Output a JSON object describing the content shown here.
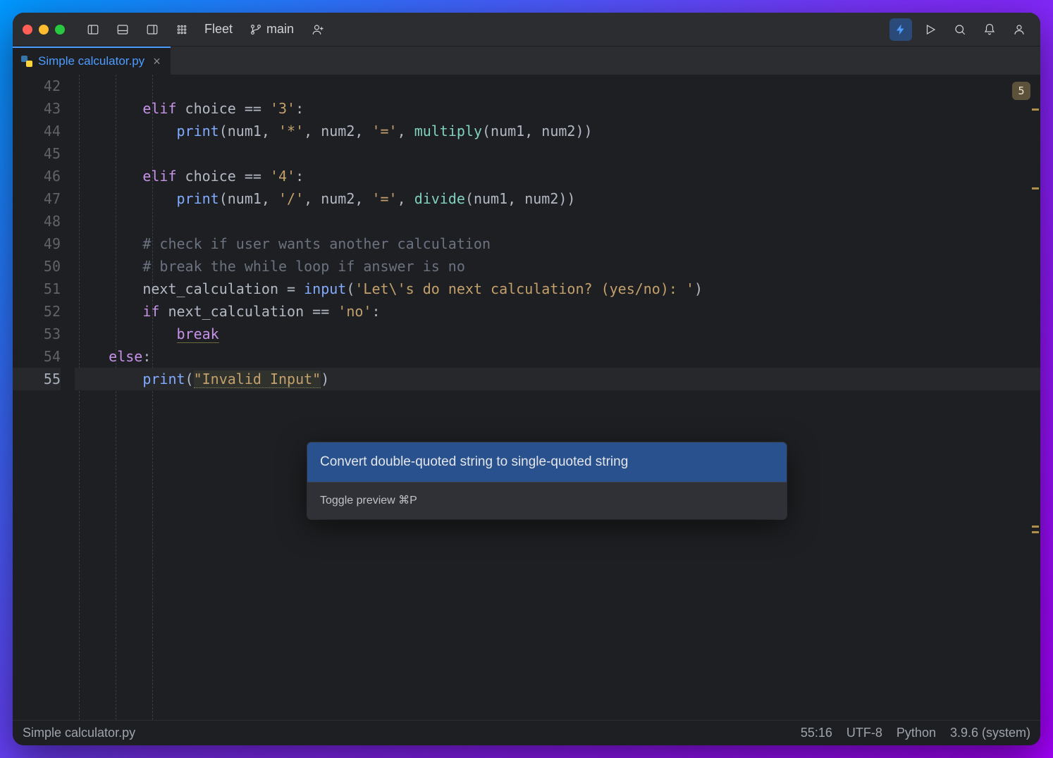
{
  "app": {
    "name": "Fleet"
  },
  "branch": {
    "name": "main"
  },
  "tab": {
    "filename": "Simple calculator.py"
  },
  "problems": {
    "count": "5"
  },
  "code": {
    "lines": [
      {
        "n": "42",
        "indent": "            ",
        "tokens": []
      },
      {
        "n": "43",
        "indent": "        ",
        "tokens": [
          [
            "kw",
            "elif"
          ],
          [
            "op",
            " choice == "
          ],
          [
            "str",
            "'3'"
          ],
          [
            "op",
            ":"
          ]
        ]
      },
      {
        "n": "44",
        "indent": "            ",
        "tokens": [
          [
            "fn",
            "print"
          ],
          [
            "op",
            "(num1, "
          ],
          [
            "str",
            "'*'"
          ],
          [
            "op",
            ", num2, "
          ],
          [
            "str",
            "'='"
          ],
          [
            "op",
            ", "
          ],
          [
            "call",
            "multiply"
          ],
          [
            "op",
            "(num1, num2))"
          ]
        ]
      },
      {
        "n": "45",
        "indent": "",
        "tokens": []
      },
      {
        "n": "46",
        "indent": "        ",
        "tokens": [
          [
            "kw",
            "elif"
          ],
          [
            "op",
            " choice == "
          ],
          [
            "str",
            "'4'"
          ],
          [
            "op",
            ":"
          ]
        ]
      },
      {
        "n": "47",
        "indent": "            ",
        "tokens": [
          [
            "fn",
            "print"
          ],
          [
            "op",
            "(num1, "
          ],
          [
            "str",
            "'/'"
          ],
          [
            "op",
            ", num2, "
          ],
          [
            "str",
            "'='"
          ],
          [
            "op",
            ", "
          ],
          [
            "call",
            "divide"
          ],
          [
            "op",
            "(num1, num2))"
          ]
        ]
      },
      {
        "n": "48",
        "indent": "",
        "tokens": []
      },
      {
        "n": "49",
        "indent": "        ",
        "tokens": [
          [
            "cmt",
            "# check if user wants another calculation"
          ]
        ]
      },
      {
        "n": "50",
        "indent": "        ",
        "tokens": [
          [
            "cmt",
            "# break the while loop if answer is no"
          ]
        ]
      },
      {
        "n": "51",
        "indent": "        ",
        "tokens": [
          [
            "id",
            "next_calculation = "
          ],
          [
            "fn",
            "input"
          ],
          [
            "op",
            "("
          ],
          [
            "str",
            "'Let\\'s do next calculation? (yes/no): '"
          ],
          [
            "op",
            ")"
          ]
        ]
      },
      {
        "n": "52",
        "indent": "        ",
        "tokens": [
          [
            "kw",
            "if"
          ],
          [
            "op",
            " next_calculation == "
          ],
          [
            "str",
            "'no'"
          ],
          [
            "op",
            ":"
          ]
        ]
      },
      {
        "n": "53",
        "indent": "            ",
        "tokens": [
          [
            "kw underline-soft",
            "break"
          ]
        ]
      },
      {
        "n": "54",
        "indent": "    ",
        "tokens": [
          [
            "kw",
            "else"
          ],
          [
            "op",
            ":"
          ]
        ]
      },
      {
        "n": "55",
        "indent": "        ",
        "hl": true,
        "tokens": [
          [
            "fn",
            "print"
          ],
          [
            "op",
            "("
          ],
          [
            "str str-hl",
            "\"Invalid Input\""
          ],
          [
            "op",
            ")"
          ]
        ]
      }
    ]
  },
  "popup": {
    "action": "Convert double-quoted string to single-quoted string",
    "footer": "Toggle preview ⌘P"
  },
  "status": {
    "file": "Simple calculator.py",
    "pos": "55:16",
    "enc": "UTF-8",
    "lang": "Python",
    "runtime": "3.9.6 (system)"
  }
}
